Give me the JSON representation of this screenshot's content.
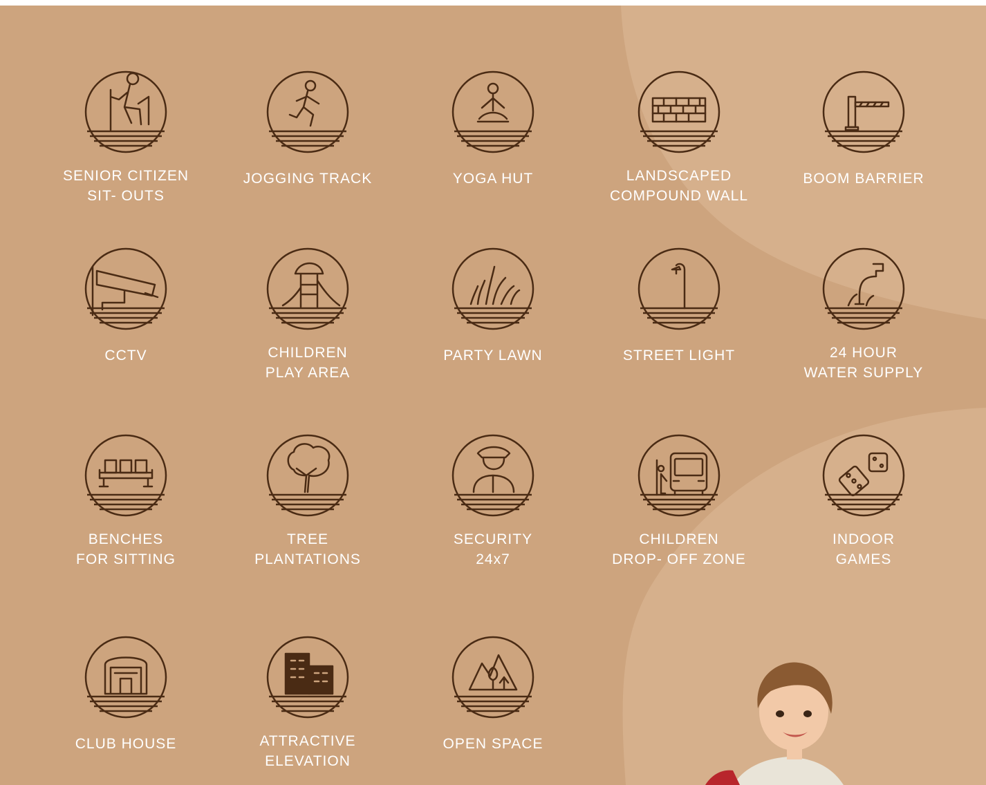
{
  "colors": {
    "background": "#cda47e",
    "lighter_arc": "#d6b08c",
    "icon_stroke": "#4a2b14",
    "label": "#ffffff"
  },
  "amenities": [
    {
      "label_lines": [
        "SENIOR CITIZEN",
        "SIT- OUTS"
      ],
      "icon": "senior-citizen-seat-icon"
    },
    {
      "label_lines": [
        "JOGGING TRACK"
      ],
      "icon": "jogging-runner-icon"
    },
    {
      "label_lines": [
        "YOGA HUT"
      ],
      "icon": "yoga-pose-icon"
    },
    {
      "label_lines": [
        "LANDSCAPED",
        "COMPOUND WALL"
      ],
      "icon": "brick-wall-icon"
    },
    {
      "label_lines": [
        "BOOM BARRIER"
      ],
      "icon": "boom-barrier-icon"
    },
    {
      "label_lines": [
        "CCTV"
      ],
      "icon": "cctv-camera-icon"
    },
    {
      "label_lines": [
        "CHILDREN",
        "PLAY AREA"
      ],
      "icon": "slide-playground-icon"
    },
    {
      "label_lines": [
        "PARTY LAWN"
      ],
      "icon": "grass-lawn-icon"
    },
    {
      "label_lines": [
        "STREET LIGHT"
      ],
      "icon": "street-lamp-icon"
    },
    {
      "label_lines": [
        "24 HOUR",
        "WATER SUPPLY"
      ],
      "icon": "water-tap-icon"
    },
    {
      "label_lines": [
        "BENCHES",
        "FOR SITTING"
      ],
      "icon": "bench-seats-icon"
    },
    {
      "label_lines": [
        "TREE",
        "PLANTATIONS"
      ],
      "icon": "tree-icon"
    },
    {
      "label_lines": [
        "SECURITY",
        "24x7"
      ],
      "icon": "security-guard-icon"
    },
    {
      "label_lines": [
        "CHILDREN",
        "DROP- OFF ZONE"
      ],
      "icon": "school-bus-icon"
    },
    {
      "label_lines": [
        "INDOOR",
        "GAMES"
      ],
      "icon": "dice-icon"
    },
    {
      "label_lines": [
        "CLUB HOUSE"
      ],
      "icon": "club-house-icon"
    },
    {
      "label_lines": [
        "ATTRACTIVE",
        "ELEVATION"
      ],
      "icon": "building-icon"
    },
    {
      "label_lines": [
        "OPEN SPACE"
      ],
      "icon": "open-space-trees-icon"
    }
  ]
}
